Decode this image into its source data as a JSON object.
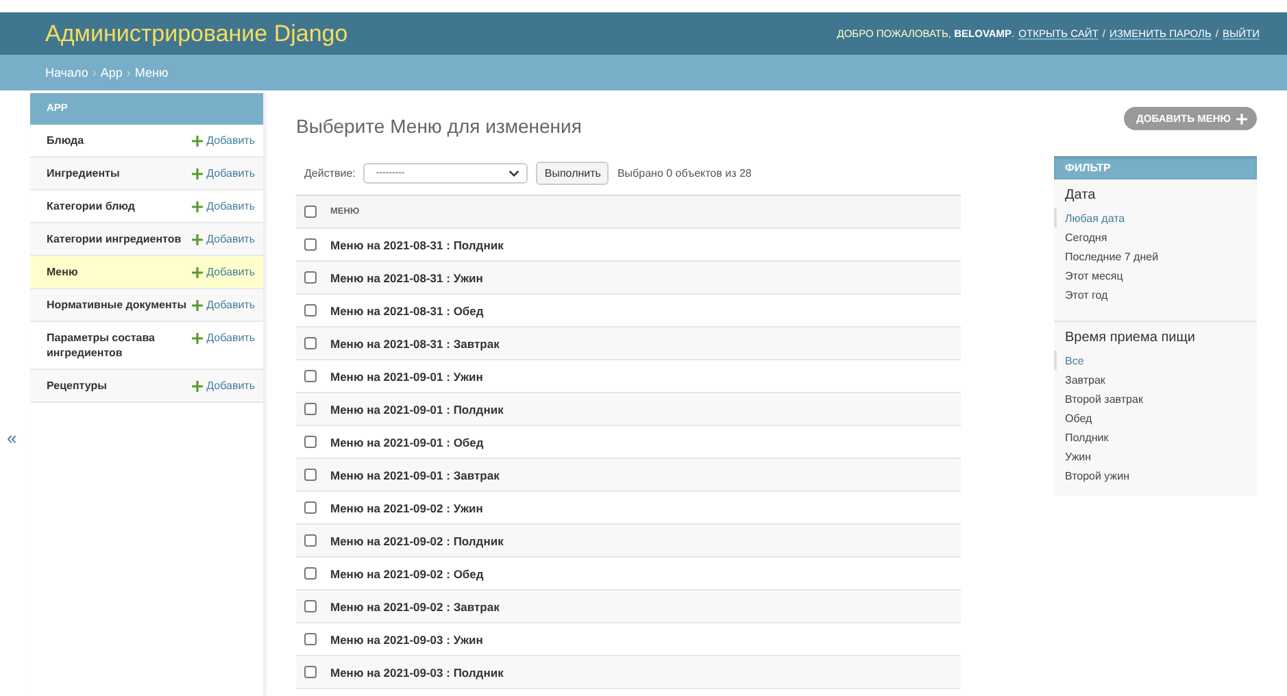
{
  "header": {
    "title": "Администрирование Django",
    "welcome": "ДОБРО ПОЖАЛОВАТЬ, **BELOVAMP**.",
    "links": [
      "ОТКРЫТЬ САЙТ",
      "ИЗМЕНИТЬ ПАРОЛЬ",
      "ВЫЙТИ"
    ],
    "separator": "/"
  },
  "breadcrumbs": [
    "Начало",
    "App",
    "Меню"
  ],
  "breadcrumb_separator": "›",
  "sidebar": {
    "collapse": "«",
    "section": "APP",
    "items": [
      {
        "label": "Блюда",
        "add": "Добавить",
        "selected": false
      },
      {
        "label": "Ингредиенты",
        "add": "Добавить",
        "selected": false
      },
      {
        "label": "Категории блюд",
        "add": "Добавить",
        "selected": false
      },
      {
        "label": "Категории ингредиентов",
        "add": "Добавить",
        "selected": false
      },
      {
        "label": "Меню",
        "add": "Добавить",
        "selected": true
      },
      {
        "label": "Нормативные документы",
        "add": "Добавить",
        "selected": false
      },
      {
        "label": "Параметры состава ингредиентов",
        "add": "Добавить",
        "selected": false
      },
      {
        "label": "Рецептуры",
        "add": "Добавить",
        "selected": false
      }
    ]
  },
  "page_title": "Выберите Меню для изменения",
  "add_button": "ДОБАВИТЬ МЕНЮ",
  "actions": {
    "label": "Действие:",
    "select_value": "---------",
    "run": "Выполнить",
    "counter": "Выбрано 0 объектов из 28"
  },
  "table": {
    "column": "МЕНЮ",
    "header_checked": false,
    "rows": [
      {
        "text": "Меню на 2021-08-31 : Полдник",
        "checked": false
      },
      {
        "text": "Меню на 2021-08-31 : Ужин",
        "checked": false
      },
      {
        "text": "Меню на 2021-08-31 : Обед",
        "checked": false
      },
      {
        "text": "Меню на 2021-08-31 : Завтрак",
        "checked": false
      },
      {
        "text": "Меню на 2021-09-01 : Ужин",
        "checked": false
      },
      {
        "text": "Меню на 2021-09-01 : Полдник",
        "checked": false
      },
      {
        "text": "Меню на 2021-09-01 : Обед",
        "checked": false
      },
      {
        "text": "Меню на 2021-09-01 : Завтрак",
        "checked": false
      },
      {
        "text": "Меню на 2021-09-02 : Ужин",
        "checked": false
      },
      {
        "text": "Меню на 2021-09-02 : Полдник",
        "checked": false
      },
      {
        "text": "Меню на 2021-09-02 : Обед",
        "checked": false
      },
      {
        "text": "Меню на 2021-09-02 : Завтрак",
        "checked": false
      },
      {
        "text": "Меню на 2021-09-03 : Ужин",
        "checked": false
      },
      {
        "text": "Меню на 2021-09-03 : Полдник",
        "checked": false
      }
    ]
  },
  "filter": {
    "title": "ФИЛЬТР",
    "groups": [
      {
        "title": "Дата",
        "choices": [
          {
            "label": "Любая дата",
            "selected": true
          },
          {
            "label": "Сегодня",
            "selected": false
          },
          {
            "label": "Последние 7 дней",
            "selected": false
          },
          {
            "label": "Этот месяц",
            "selected": false
          },
          {
            "label": "Этот год",
            "selected": false
          }
        ]
      },
      {
        "title": "Время приема пищи",
        "choices": [
          {
            "label": "Все",
            "selected": true
          },
          {
            "label": "Завтрак",
            "selected": false
          },
          {
            "label": "Второй завтрак",
            "selected": false
          },
          {
            "label": "Обед",
            "selected": false
          },
          {
            "label": "Полдник",
            "selected": false
          },
          {
            "label": "Ужин",
            "selected": false
          },
          {
            "label": "Второй ужин",
            "selected": false
          }
        ]
      }
    ]
  }
}
